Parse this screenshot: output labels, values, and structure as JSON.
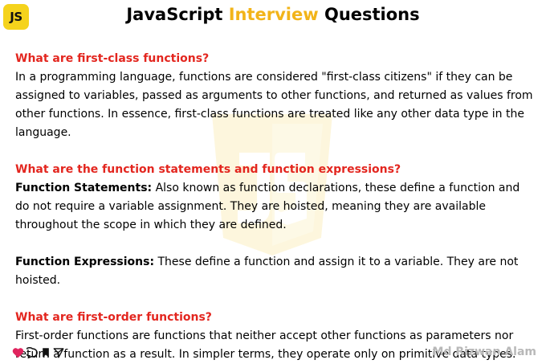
{
  "logo": {
    "text": "JS"
  },
  "header": {
    "title_part1": "JavaScript ",
    "title_highlight": "Interview",
    "title_part2": " Questions"
  },
  "sections": [
    {
      "question": "What are first-class functions?",
      "answer": "In a programming language, functions are considered \"first-class citizens\" if they can be assigned to variables, passed as arguments to other functions, and returned as values from other functions. In essence, first-class functions are treated like any other data type in the language."
    },
    {
      "question": "What are the function statements and function expressions?",
      "term1": "Function Statements:",
      "desc1": " Also known as function declarations, these define a function and do not require a variable assignment. They are hoisted, meaning they are available throughout the scope in which they are defined.",
      "term2": "Function Expressions:",
      "desc2": " These define a function and assign it to a variable. They are not hoisted."
    },
    {
      "question": "What are first-order functions?",
      "answer": "First-order functions are functions that neither accept other functions as parameters nor return a function as a result. In simpler terms, they operate only on primitive data types."
    }
  ],
  "footer": {
    "author": "Md Rizwan Alam",
    "icons": [
      "heart-icon",
      "comment-icon",
      "bookmark-icon",
      "share-icon"
    ]
  },
  "colors": {
    "accent_yellow": "#f2b419",
    "question_red": "#e3261f",
    "logo_bg": "#f5d31c",
    "heart_red": "#e0245e",
    "author_gray": "#b8b8b8"
  }
}
